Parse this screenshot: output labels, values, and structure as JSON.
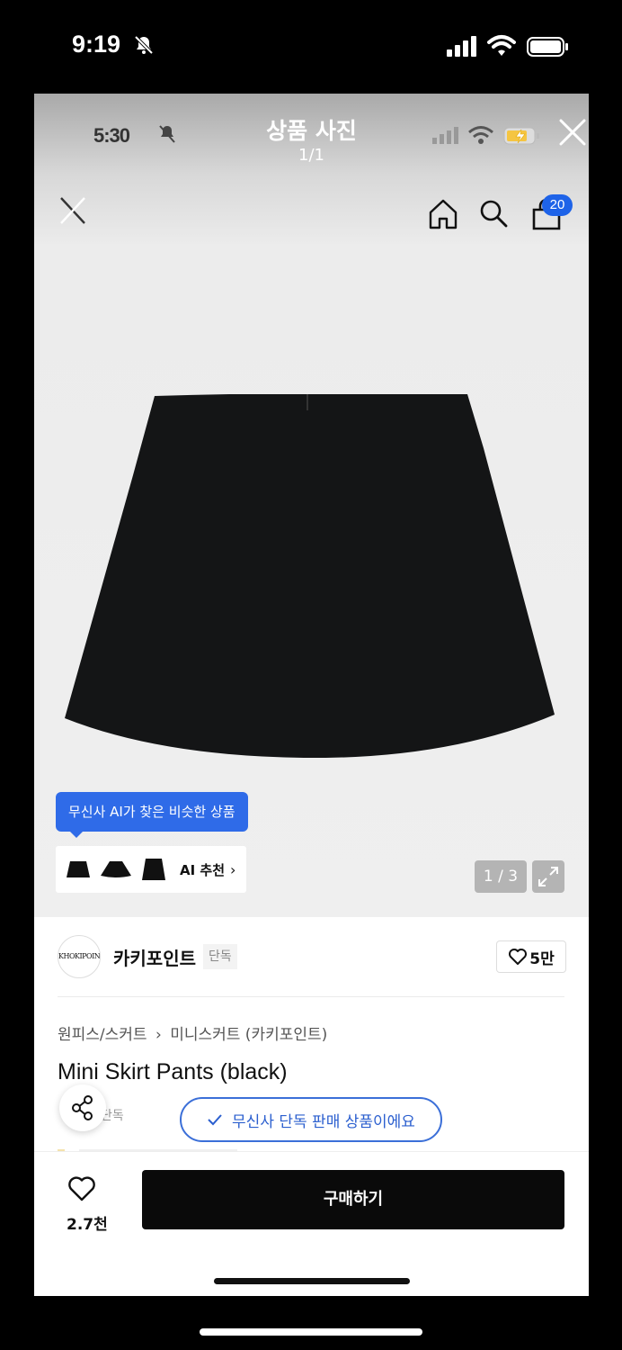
{
  "outer_status": {
    "time": "9:19"
  },
  "inner_status": {
    "time": "5:30"
  },
  "viewer": {
    "title": "상품 사진",
    "counter": "1/1"
  },
  "header": {
    "cart_count": "20"
  },
  "ai": {
    "tooltip": "무신사 AI가 찾은 비슷한 상품",
    "label": "AI 추천"
  },
  "image": {
    "counter": "1 / 3"
  },
  "brand": {
    "logo_text": "KHOKIPOINT",
    "name": "카키포인트",
    "tag": "단독",
    "likes": "5만"
  },
  "breadcrumb": {
    "category": "원피스/스커트",
    "separator": "›",
    "subcategory": "미니스커트 (카키포인트)"
  },
  "product": {
    "title": "Mini Skirt Pants (black)",
    "exclusive_tag": "단독"
  },
  "toast": {
    "message": "무신사 단독 판매 상품이에요"
  },
  "bottom": {
    "wish_count": "2.7천",
    "buy_label": "구매하기"
  },
  "colors": {
    "accent": "#2f6be8",
    "buy": "#0a0a0a",
    "product": "#141516"
  }
}
